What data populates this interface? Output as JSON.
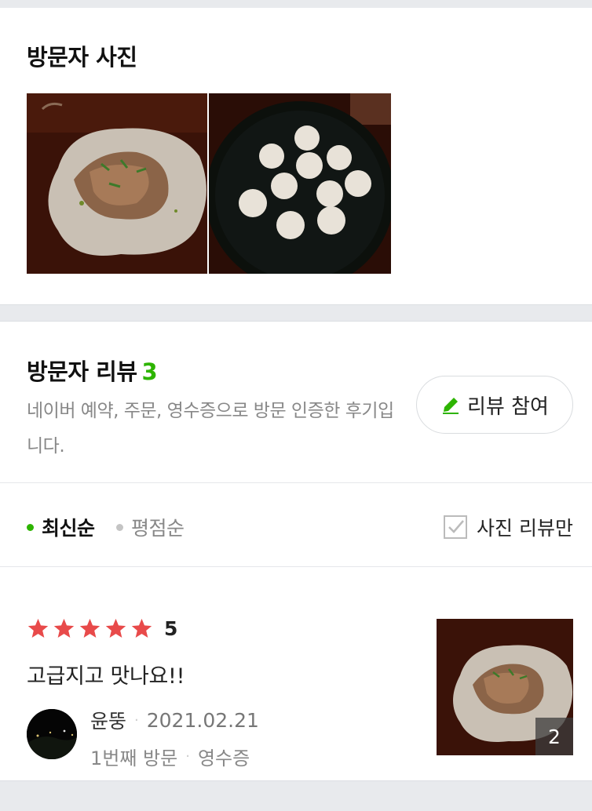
{
  "photos": {
    "title": "방문자 사진"
  },
  "reviews": {
    "title": "방문자 리뷰",
    "count": "3",
    "description": "네이버 예약, 주문, 영수증으로 방문 인증한 후기입니다.",
    "join_button_label": "리뷰 참여"
  },
  "sort": {
    "latest_label": "최신순",
    "rating_label": "평점순",
    "photo_only_label": "사진 리뷰만"
  },
  "review_item": {
    "rating": "5",
    "stars_filled": 5,
    "text": "고급지고 맛나요!!",
    "author": "윤뚱",
    "date": "2021.02.21",
    "visit": "1번째 방문",
    "proof": "영수증",
    "photo_count": "2"
  },
  "colors": {
    "accent_green": "#2db400",
    "star_red": "#e84a4a"
  }
}
